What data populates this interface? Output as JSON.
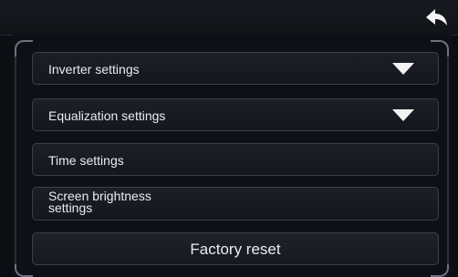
{
  "header": {
    "back_icon": "back-arrow-icon"
  },
  "settings": {
    "inverter": {
      "label": "Inverter settings",
      "icon": "dropdown-triangle-icon"
    },
    "equalization": {
      "label": "Equalization settings",
      "icon": "dropdown-triangle-icon"
    },
    "time": {
      "label": "Time settings"
    },
    "brightness": {
      "label_line1": "Screen brightness",
      "label_line2": "settings"
    },
    "factory_reset": {
      "label": "Factory reset"
    }
  },
  "colors": {
    "background": "#0c0e13",
    "row_border": "#3a4049",
    "text": "#e9ecef"
  }
}
